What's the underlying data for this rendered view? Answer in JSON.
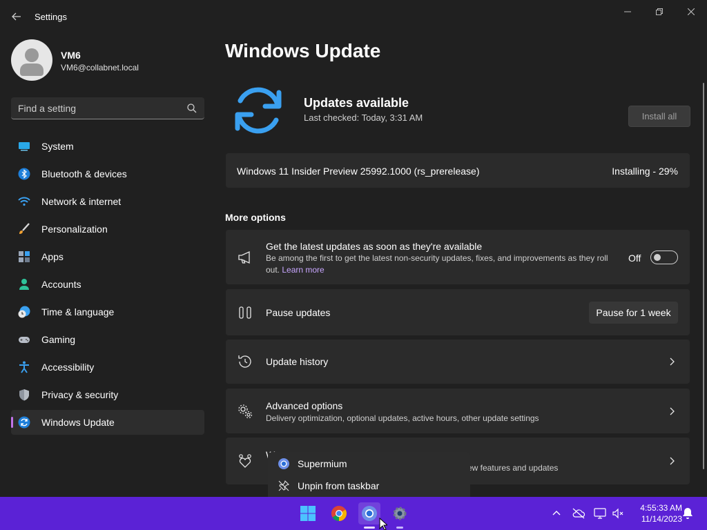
{
  "window": {
    "title": "Settings",
    "back_icon": "back-arrow-icon",
    "minimize_icon": "minimize-icon",
    "maximize_icon": "restore-icon",
    "close_icon": "close-icon"
  },
  "profile": {
    "name": "VM6",
    "email": "VM6@collabnet.local"
  },
  "search": {
    "placeholder": "Find a setting",
    "icon": "search-icon"
  },
  "sidebar": {
    "items": [
      {
        "label": "System",
        "icon": "system-icon"
      },
      {
        "label": "Bluetooth & devices",
        "icon": "bluetooth-icon"
      },
      {
        "label": "Network & internet",
        "icon": "wifi-icon"
      },
      {
        "label": "Personalization",
        "icon": "brush-icon"
      },
      {
        "label": "Apps",
        "icon": "apps-icon"
      },
      {
        "label": "Accounts",
        "icon": "accounts-icon"
      },
      {
        "label": "Time & language",
        "icon": "time-language-icon"
      },
      {
        "label": "Gaming",
        "icon": "gamepad-icon"
      },
      {
        "label": "Accessibility",
        "icon": "accessibility-icon"
      },
      {
        "label": "Privacy & security",
        "icon": "shield-icon"
      },
      {
        "label": "Windows Update",
        "icon": "windows-update-icon",
        "active": true
      }
    ]
  },
  "main": {
    "title": "Windows Update",
    "status_title": "Updates available",
    "last_checked": "Last checked: Today, 3:31 AM",
    "install_all_label": "Install all",
    "update": {
      "name": "Windows 11 Insider Preview 25992.1000 (rs_prerelease)",
      "status": "Installing - 29%",
      "progress_percent": 29
    },
    "more_options_label": "More options",
    "options": {
      "latest": {
        "title": "Get the latest updates as soon as they're available",
        "desc": "Be among the first to get the latest non-security updates, fixes, and improvements as they roll out.",
        "link": "Learn more",
        "toggle_label": "Off",
        "toggle_on": false
      },
      "pause": {
        "title": "Pause updates",
        "button": "Pause for 1 week"
      },
      "history": {
        "title": "Update history"
      },
      "advanced": {
        "title": "Advanced options",
        "desc": "Delivery optimization, optional updates, active hours, other update settings"
      },
      "insider": {
        "title_partial": "W",
        "desc_partial": "ew features and updates"
      }
    }
  },
  "context_menu": {
    "items": [
      {
        "label": "Supermium",
        "icon": "supermium-icon"
      },
      {
        "label": "Unpin from taskbar",
        "icon": "unpin-icon"
      }
    ]
  },
  "taskbar": {
    "color": "#5b22d6",
    "apps": [
      "start-icon",
      "chrome-icon",
      "supermium-icon",
      "settings-icon"
    ],
    "time": "4:55:33 AM",
    "date": "11/14/2023"
  },
  "colors": {
    "accent": "#c174e8",
    "link": "#c8a6ff",
    "update_icon": "#3aa0f0"
  }
}
